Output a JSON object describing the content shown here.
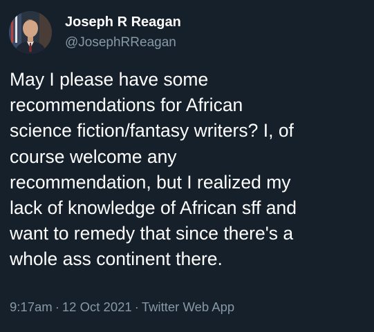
{
  "author": {
    "display_name": "Joseph R Reagan",
    "handle": "@JosephRReagan",
    "avatar_icon": "avatar-portrait"
  },
  "tweet": {
    "text": "May I please have some\nrecommendations for African\nscience fiction/fantasy writers? I, of\ncourse welcome any\nrecommendation, but I realized my\nlack of knowledge of African sff and\nwant to remedy that since there's a\nwhole ass continent there."
  },
  "meta": {
    "time": "9:17am",
    "separator": "·",
    "date": "12 Oct 2021",
    "source": "Twitter Web App"
  },
  "colors": {
    "background": "#15202b",
    "primary_text": "#ffffff",
    "secondary_text": "#8899a6"
  }
}
